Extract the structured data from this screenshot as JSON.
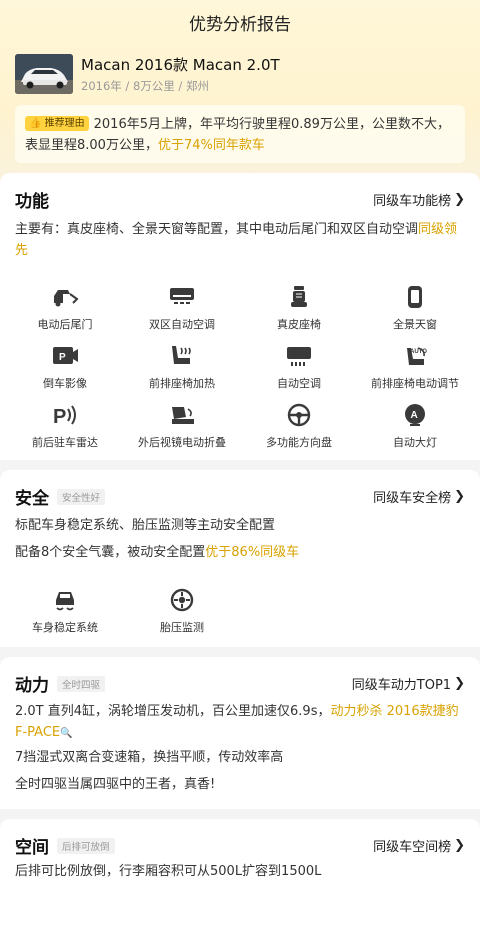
{
  "header": {
    "title": "优势分析报告"
  },
  "car": {
    "title": "Macan 2016款 Macan 2.0T",
    "meta": "2016年 / 8万公里 / 郑州"
  },
  "reason": {
    "tag": "推荐理由",
    "text": "2016年5月上牌，年平均行驶里程0.89万公里，公里数不大，表显里程8.00万公里，",
    "highlight": "优于74%同年款车"
  },
  "function": {
    "title": "功能",
    "link": "同级车功能榜",
    "summary": "主要有：真皮座椅、全景天窗等配置，其中电动后尾门和双区自动空调",
    "summary_highlight": "同级领先",
    "features": [
      {
        "label": "电动后尾门",
        "icon": "tailgate-icon"
      },
      {
        "label": "双区自动空调",
        "icon": "dual-ac-icon"
      },
      {
        "label": "真皮座椅",
        "icon": "leather-seat-icon"
      },
      {
        "label": "全景天窗",
        "icon": "sunroof-icon"
      },
      {
        "label": "倒车影像",
        "icon": "rear-camera-icon"
      },
      {
        "label": "前排座椅加热",
        "icon": "seat-heating-icon"
      },
      {
        "label": "自动空调",
        "icon": "auto-ac-icon"
      },
      {
        "label": "前排座椅电动调节",
        "icon": "seat-adjust-icon"
      },
      {
        "label": "前后驻车雷达",
        "icon": "parking-radar-icon"
      },
      {
        "label": "外后视镜电动折叠",
        "icon": "mirror-fold-icon"
      },
      {
        "label": "多功能方向盘",
        "icon": "steering-wheel-icon"
      },
      {
        "label": "自动大灯",
        "icon": "auto-headlight-icon"
      }
    ]
  },
  "safety": {
    "title": "安全",
    "tag": "安全性好",
    "link": "同级车安全榜",
    "line1": "标配车身稳定系统、胎压监测等主动安全配置",
    "line2": "配备8个安全气囊，被动安全配置",
    "line2_highlight": "优于86%同级车",
    "features": [
      {
        "label": "车身稳定系统",
        "icon": "stability-icon"
      },
      {
        "label": "胎压监测",
        "icon": "tire-pressure-icon"
      }
    ]
  },
  "power": {
    "title": "动力",
    "tag": "全时四驱",
    "link": "同级车动力TOP1",
    "line1": "2.0T 直列4缸，涡轮增压发动机，百公里加速仅6.9s，",
    "line1_highlight": "动力秒杀 2016款捷豹F-PACE",
    "line2": "7挡湿式双离合变速箱，换挡平顺，传动效率高",
    "line3": "全时四驱当属四驱中的王者，真香!"
  },
  "space": {
    "title": "空间",
    "tag": "后排可放倒",
    "link": "同级车空间榜",
    "line1": "后排可比例放倒，行李厢容积可从500L扩容到1500L"
  },
  "colors": {
    "accent": "#d9a200",
    "tag_yellow": "#ffd23e"
  }
}
